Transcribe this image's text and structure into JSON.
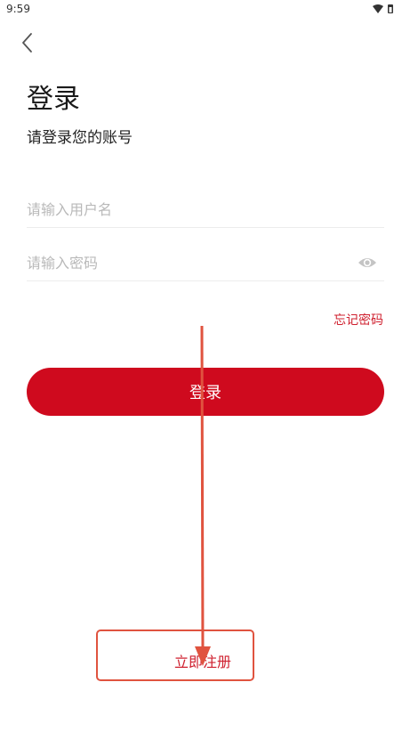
{
  "status_bar": {
    "time": "9:59"
  },
  "header": {
    "back_icon": "chevron-left-icon"
  },
  "login": {
    "title": "登录",
    "subtitle": "请登录您的账号",
    "username_placeholder": "请输入用户名",
    "password_placeholder": "请输入密码",
    "password_visibility_icon": "eye-icon",
    "forgot_password": "忘记密码",
    "submit_label": "登录",
    "register_label": "立即注册"
  },
  "colors": {
    "primary": "#cf0a1e",
    "link": "#cf1f2e",
    "annotation": "#e0533f",
    "placeholder": "#b9b9b9"
  }
}
